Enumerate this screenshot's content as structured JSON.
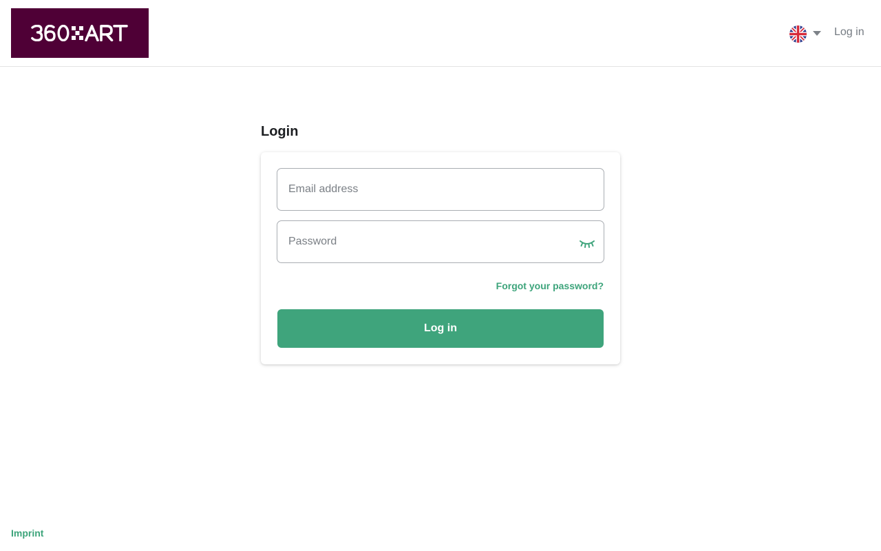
{
  "header": {
    "logo_alt": "360XART",
    "language": {
      "flag_icon": "uk-flag-icon",
      "dropdown_icon": "caret-down-icon"
    },
    "login_link": "Log in"
  },
  "login": {
    "title": "Login",
    "email_placeholder": "Email address",
    "password_placeholder": "Password",
    "password_toggle_icon": "eye-closed-icon",
    "forgot_link": "Forgot your password?",
    "submit_label": "Log in"
  },
  "footer": {
    "imprint_link": "Imprint"
  },
  "colors": {
    "brand": "#4f0036",
    "accent": "#3fa47c",
    "muted_text": "#757b82"
  }
}
